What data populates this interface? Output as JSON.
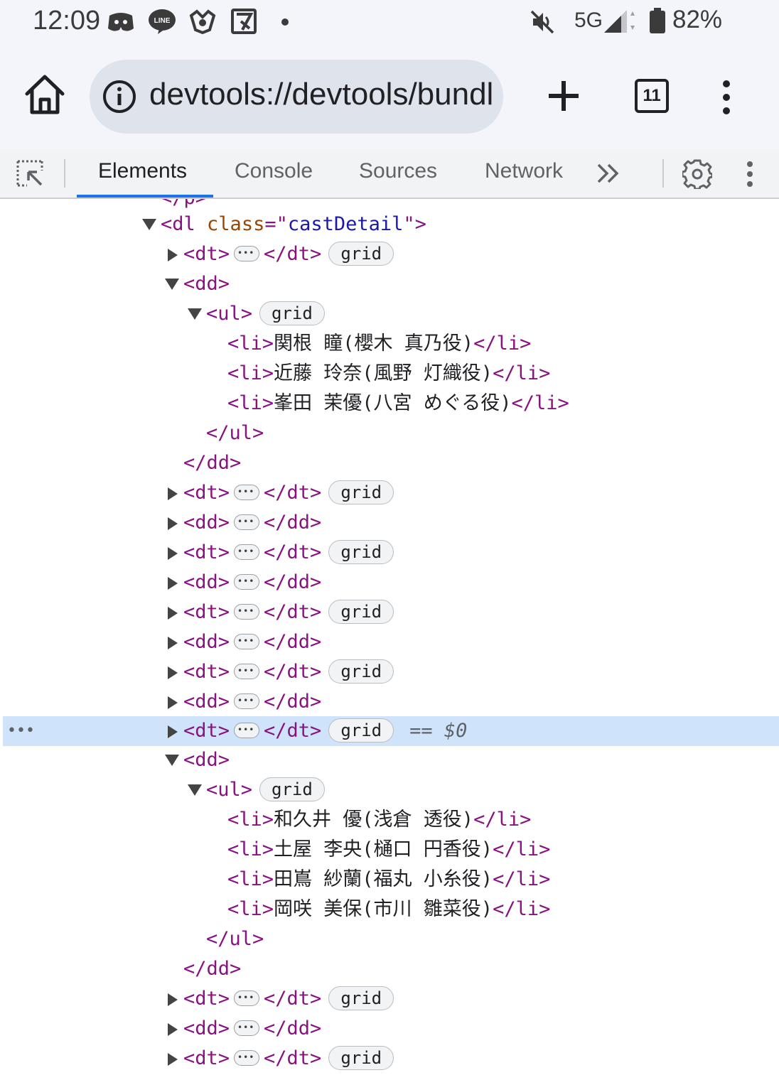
{
  "status_bar": {
    "time": "12:09",
    "network": "5G",
    "battery": "82%",
    "icons": [
      "discord-icon",
      "line-icon",
      "app-icon",
      "notification-app-icon",
      "dot-icon",
      "mute-icon",
      "signal-icon",
      "battery-icon"
    ]
  },
  "browser": {
    "url": "devtools://devtools/bundl",
    "tab_count": "11"
  },
  "devtools": {
    "tabs": [
      {
        "label": "Elements",
        "active": true
      },
      {
        "label": "Console",
        "active": false
      },
      {
        "label": "Sources",
        "active": false
      },
      {
        "label": "Network",
        "active": false
      }
    ]
  },
  "tree": {
    "partial_top": "</p>",
    "dl_open": {
      "tag": "<dl",
      "attr": "class",
      "eq": "=\"",
      "value": "castDetail",
      "close": "\">"
    },
    "dt_open": "<dt>",
    "dt_close": "</dt>",
    "dd_open": "<dd>",
    "dd_close": "</dd>",
    "ul_open": "<ul>",
    "ul_close": "</ul>",
    "li_open": "<li>",
    "li_close": "</li>",
    "badge": "grid",
    "selected_suffix": "== $0",
    "row_dots": "•••",
    "list1": [
      "関根 瞳(櫻木 真乃役)",
      "近藤 玲奈(風野 灯織役)",
      "峯田 茉優(八宮 めぐる役)"
    ],
    "list2": [
      "和久井 優(浅倉 透役)",
      "土屋 李央(樋口 円香役)",
      "田嶌 紗蘭(福丸 小糸役)",
      "岡咲 美保(市川 雛菜役)"
    ]
  }
}
